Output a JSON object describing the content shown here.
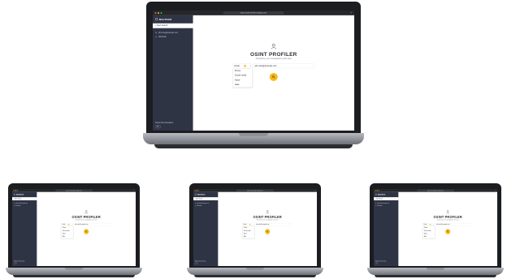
{
  "window": {
    "url": "https://osint-profiler.maltego.com"
  },
  "sidebar": {
    "brand": "MALTEGO",
    "new_search_label": "New Search",
    "items": [
      {
        "label": "john.doe@example.com",
        "icon": "mail-icon"
      },
      {
        "label": "Sebastian",
        "icon": "user-icon"
      }
    ],
    "footer": "FAQ & Documentation",
    "language": "EN"
  },
  "main": {
    "title": "OSINT PROFILER",
    "subtitle": "Streamline your investigations with ease",
    "type_select": {
      "value": "Email",
      "options": [
        "Phone",
        "Social media",
        "Name",
        "Alias"
      ]
    },
    "query_input": {
      "value": "john.doe@example.com"
    }
  },
  "colors": {
    "sidebar": "#2f3445",
    "accent": "#f6b818",
    "chrome": "#26272b"
  }
}
